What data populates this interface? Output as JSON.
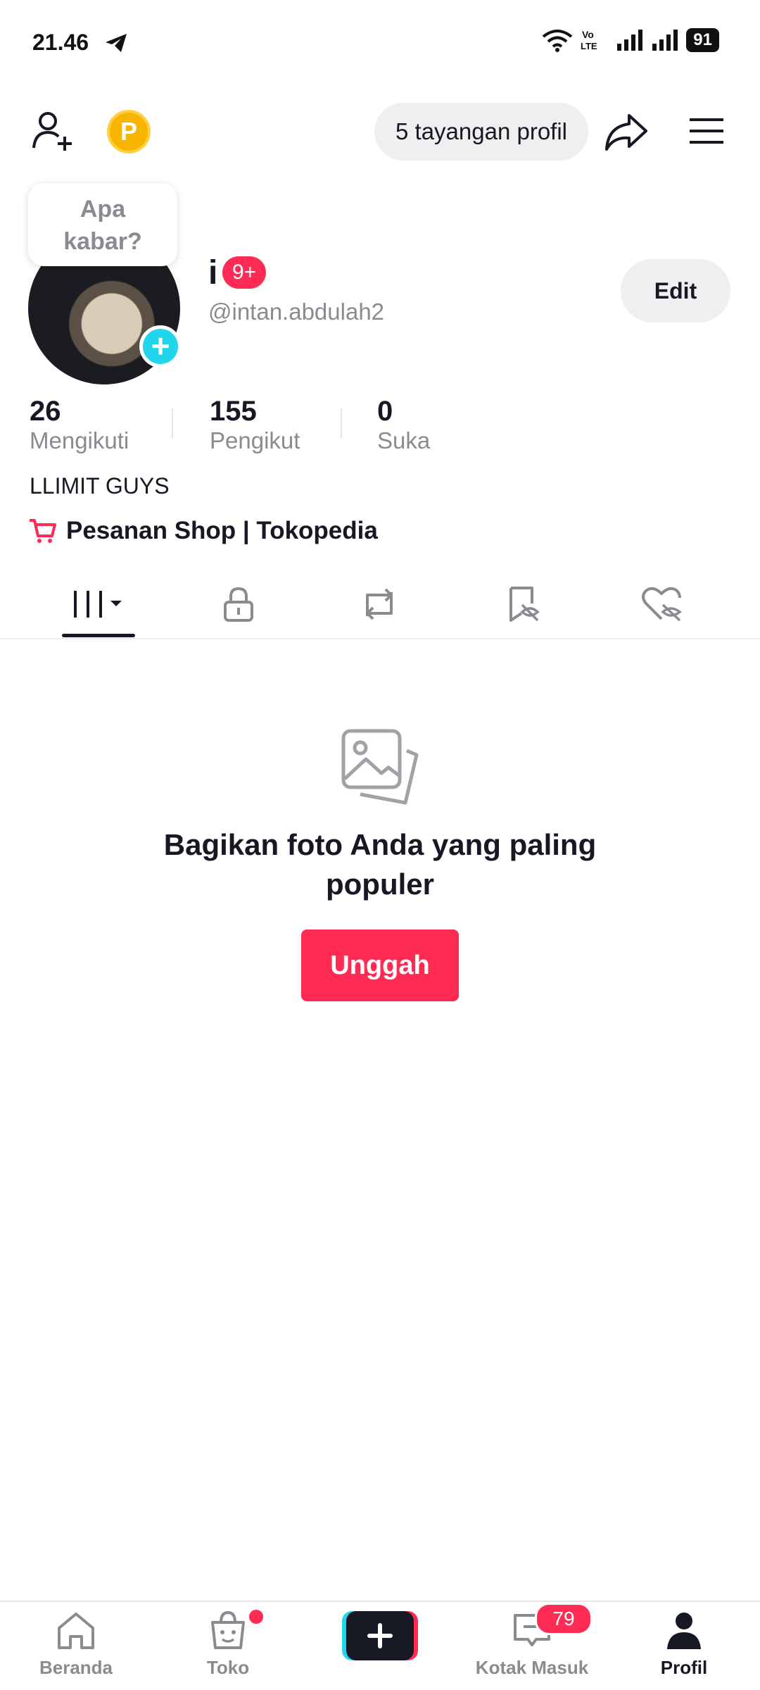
{
  "status_bar": {
    "time": "21.46",
    "battery": "91",
    "icons": [
      "telegram-icon",
      "wifi-icon",
      "volte-icon",
      "signal-icon",
      "signal-icon",
      "battery-icon"
    ]
  },
  "top_bar": {
    "profile_views": "5 tayangan profil",
    "coin_label": "P"
  },
  "profile": {
    "bubble_text_line1": "Apa",
    "bubble_text_line2": "kabar?",
    "display_name": "i",
    "badge": "9+",
    "username": "@intan.abdulah2",
    "edit_label": "Edit",
    "bio": "LLIMIT GUYS",
    "shop_link": "Pesanan Shop | Tokopedia"
  },
  "stats": [
    {
      "value": "26",
      "label": "Mengikuti"
    },
    {
      "value": "155",
      "label": "Pengikut"
    },
    {
      "value": "0",
      "label": "Suka"
    }
  ],
  "tabs": [
    "grid-icon",
    "lock-icon",
    "repost-icon",
    "saved-hidden-icon",
    "liked-hidden-icon"
  ],
  "empty_state": {
    "title_line1": "Bagikan foto Anda yang paling",
    "title_line2": "populer",
    "button": "Unggah"
  },
  "bottom_nav": {
    "items": [
      {
        "label": "Beranda"
      },
      {
        "label": "Toko"
      },
      {
        "label": "Kotak Masuk",
        "badge": "79"
      },
      {
        "label": "Profil"
      }
    ]
  },
  "colors": {
    "accent": "#fe2c55",
    "cyan": "#20d5ec",
    "gray_text": "#8a8b91"
  }
}
